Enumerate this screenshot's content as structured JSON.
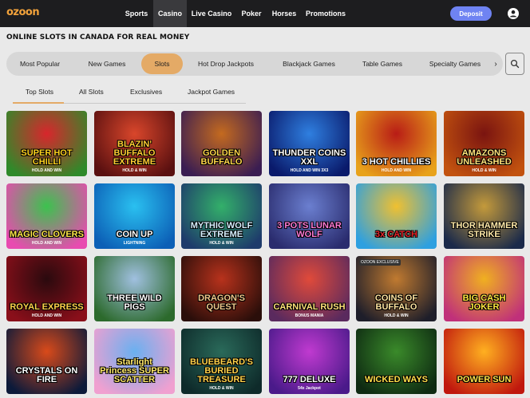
{
  "header": {
    "logo": "ozoon",
    "nav": [
      "Sports",
      "Casino",
      "Live Casino",
      "Poker",
      "Horses",
      "Promotions"
    ],
    "active_nav": "Casino",
    "deposit_label": "Deposit",
    "colors": {
      "bar": "#1d1d1f",
      "deposit": "#6f83f2",
      "logo": "#f2a23b"
    }
  },
  "page_title": "ONLINE SLOTS IN CANADA FOR REAL MONEY",
  "categories": {
    "items": [
      "Most Popular",
      "New Games",
      "Slots",
      "Hot Drop Jackpots",
      "Blackjack Games",
      "Table Games",
      "Specialty Games"
    ],
    "active": "Slots",
    "accent": "#e4aa66",
    "next_icon": "chevron-right-icon",
    "search_icon": "search-icon"
  },
  "subtabs": {
    "items": [
      "Top Slots",
      "All Slots",
      "Exclusives",
      "Jackpot Games"
    ],
    "active": "Top Slots"
  },
  "games": [
    {
      "name": "SUPER HOT CHILLI",
      "sub": "HOLD AND WIN",
      "bg": [
        "#2f8a2a",
        "#d8262c"
      ],
      "fg": "#ffd21f"
    },
    {
      "name": "BLAZIN' BUFFALO EXTREME",
      "sub": "HOLD & WIN",
      "bg": [
        "#5a1010",
        "#d9462b"
      ],
      "fg": "#ffcc33"
    },
    {
      "name": "GOLDEN BUFFALO",
      "sub": "",
      "bg": [
        "#3a1d52",
        "#c46a1f"
      ],
      "fg": "#ffd54a"
    },
    {
      "name": "THUNDER COINS XXL",
      "sub": "HOLD AND WIN 3X3",
      "bg": [
        "#0a1a6b",
        "#2f7fe0"
      ],
      "fg": "#ffffff"
    },
    {
      "name": "3 HOT CHILLIES",
      "sub": "HOLD AND WIN",
      "bg": [
        "#e8a21b",
        "#b81c16"
      ],
      "fg": "#ffffff"
    },
    {
      "name": "AMAZONS UNLEASHED",
      "sub": "HOLD & WIN",
      "bg": [
        "#c2520f",
        "#7a1410"
      ],
      "fg": "#ffe27a"
    },
    {
      "name": "MAGIC CLOVERS",
      "sub": "HOLD AND WIN",
      "bg": [
        "#e84bb0",
        "#3cc24e"
      ],
      "fg": "#ffe84a"
    },
    {
      "name": "COIN UP",
      "sub": "LIGHTNING",
      "bg": [
        "#0c5fb6",
        "#2ac0f0"
      ],
      "fg": "#ffffff"
    },
    {
      "name": "MYTHIC WOLF EXTREME",
      "sub": "HOLD & WIN",
      "bg": [
        "#1e3b6b",
        "#33b06a"
      ],
      "fg": "#d6f0ff"
    },
    {
      "name": "3 POTS LUNAR WOLF",
      "sub": "",
      "bg": [
        "#2a2c6e",
        "#6b7fd0"
      ],
      "fg": "#ff7bd6"
    },
    {
      "name": "3x CATCH",
      "sub": "",
      "bg": [
        "#2ea0e0",
        "#f0c030"
      ],
      "fg": "#e8242a"
    },
    {
      "name": "THOR HAMMER STRIKE",
      "sub": "",
      "bg": [
        "#1b2a4a",
        "#c49a3b"
      ],
      "fg": "#ffe9a8"
    },
    {
      "name": "ROYAL EXPRESS",
      "sub": "HOLD AND WIN",
      "bg": [
        "#8a0f1a",
        "#2a0a0e"
      ],
      "fg": "#ffd04a"
    },
    {
      "name": "THREE WILD PIGS",
      "sub": "",
      "bg": [
        "#2c6a2c",
        "#a0c0e0"
      ],
      "fg": "#ffffff"
    },
    {
      "name": "DRAGON'S QUEST",
      "sub": "",
      "bg": [
        "#2a0e0a",
        "#b8321c"
      ],
      "fg": "#f0c68a"
    },
    {
      "name": "CARNIVAL RUSH",
      "sub": "BONUS MANIA",
      "bg": [
        "#5a2a5e",
        "#e04a3a"
      ],
      "fg": "#ffe07a"
    },
    {
      "name": "COINS OF BUFFALO",
      "sub": "HOLD & WIN",
      "bg": [
        "#1e1e2a",
        "#c07a30"
      ],
      "fg": "#ffe4a0",
      "badge": "OZOON EXCLUSIVE"
    },
    {
      "name": "BIG CASH JOKER",
      "sub": "",
      "bg": [
        "#c0307a",
        "#f0b020"
      ],
      "fg": "#ffe640"
    },
    {
      "name": "CRYSTALS ON FIRE",
      "sub": "",
      "bg": [
        "#0c1a3a",
        "#d94a1a"
      ],
      "fg": "#ffffff"
    },
    {
      "name": "Starlight Princess SUPER SCATTER",
      "sub": "",
      "bg": [
        "#f0a0d0",
        "#6ab0f0"
      ],
      "fg": "#ffe86a"
    },
    {
      "name": "BLUEBEARD'S BURIED TREASURE",
      "sub": "HOLD & WIN",
      "bg": [
        "#0e2a2a",
        "#2a6a5a"
      ],
      "fg": "#ffd24a"
    },
    {
      "name": "777 DELUXE",
      "sub": "54x Jackpot",
      "bg": [
        "#4a1a8a",
        "#c03ad0"
      ],
      "fg": "#ffffff"
    },
    {
      "name": "WICKED WAYS",
      "sub": "",
      "bg": [
        "#0e2a12",
        "#3a8a2a"
      ],
      "fg": "#ffe04a"
    },
    {
      "name": "POWER SUN",
      "sub": "",
      "bg": [
        "#c0180e",
        "#ffb020"
      ],
      "fg": "#ffe04a"
    }
  ]
}
